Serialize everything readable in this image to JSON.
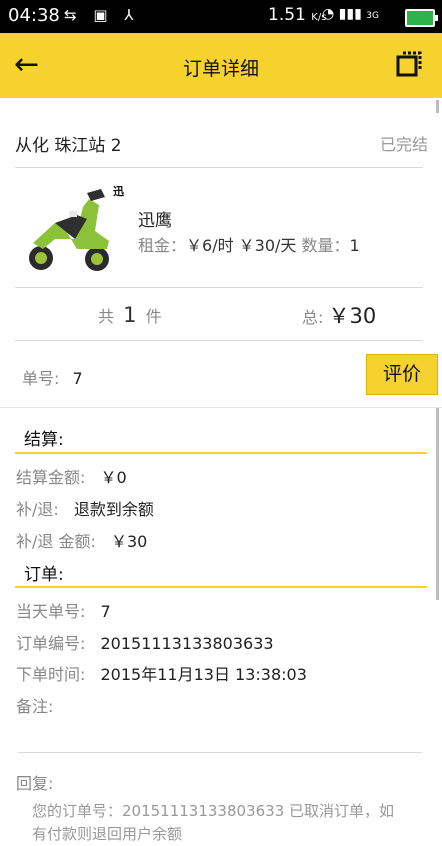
{
  "statusbar": {
    "time": "04:38",
    "speed": "1.51",
    "speed_unit": "K/s",
    "network": "3G"
  },
  "appbar": {
    "title": "订单详细"
  },
  "order": {
    "station": "从化 珠江站 2",
    "status": "已完结",
    "product": {
      "name": "迅鹰",
      "rent_label": "租金：",
      "rent_value": "￥6/时 ￥30/天",
      "qty_label": "数量：",
      "qty_value": "1",
      "image_label": "迅"
    },
    "total": {
      "count_prefix": "共",
      "count": "1",
      "count_suffix": "件",
      "total_label": "总:",
      "total_value": "￥30"
    },
    "number_label": "单号:",
    "number_value": "7",
    "rate_button": "评价"
  },
  "settlement": {
    "title": "结算:",
    "amount_label": "结算金额:",
    "amount_value": "￥0",
    "refund_label": "补/退:",
    "refund_value": "退款到余额",
    "refund_amount_label": "补/退 金额:",
    "refund_amount_value": "￥30"
  },
  "order_info": {
    "title": "订单:",
    "day_no_label": "当天单号:",
    "day_no_value": "7",
    "order_no_label": "订单编号:",
    "order_no_value": "20151113133803633",
    "time_label": "下单时间:",
    "time_value": "2015年11月13日 13:38:03",
    "note_label": "备注:"
  },
  "reply": {
    "label": "回复:",
    "text": "您的订单号：20151113133803633 已取消订单，如有付款则退回用户余额"
  },
  "colors": {
    "accent": "#f5d22d",
    "statusbar": "#000000",
    "battery": "#2fb14a"
  }
}
